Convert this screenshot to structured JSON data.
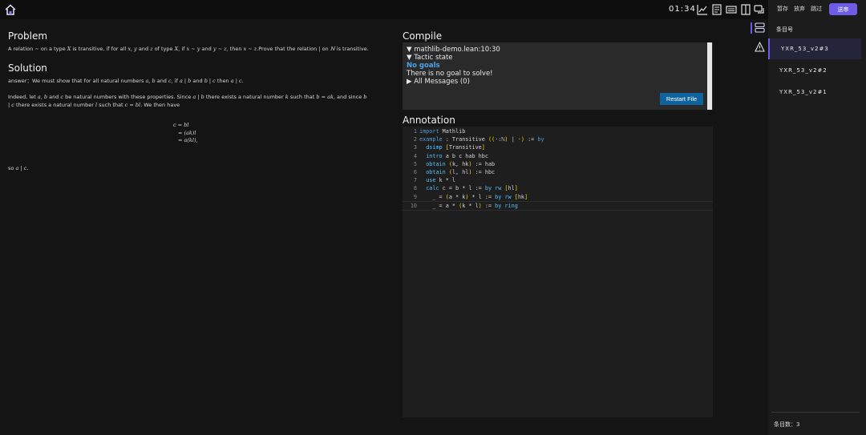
{
  "topbar": {
    "clock": "01:34",
    "icons": [
      "home-icon",
      "chart-icon",
      "document-icon",
      "keyboard-icon",
      "columns-icon",
      "chat-icon"
    ]
  },
  "problem": {
    "title": "Problem",
    "text_parts": [
      "A relation ",
      "∼",
      " on a type ",
      "X",
      " is transitive, if for all ",
      "x, y",
      " and ",
      "z",
      " of type ",
      "X,",
      " if ",
      "x ∼ y",
      " and ",
      "y ∼ z,",
      " then ",
      "x ∼ z",
      ".Prove that the relation ",
      "|",
      " on ",
      "ℕ",
      " is transitive."
    ]
  },
  "solution": {
    "title": "Solution",
    "answer_parts": [
      "answer：We must show that for all natural numbers ",
      "a, b",
      " and ",
      "c,",
      " if ",
      "a | b",
      " and ",
      "b | c",
      " then ",
      "a | c."
    ],
    "para_parts": [
      "Indeed, let ",
      "a, b",
      " and ",
      "c",
      " be natural numbers with these properties. Since ",
      "a | b",
      " there exists a natural number ",
      "k",
      " such that ",
      "b = ak,",
      " and since ",
      "b | c",
      " there exists a natural number ",
      "l",
      " such that ",
      "c = bl.",
      " We then have"
    ],
    "eq_lines": [
      "c = bl",
      "= (ak)l",
      "= a(kl),"
    ],
    "conclusion_parts": [
      "so ",
      "a | c."
    ]
  },
  "compile": {
    "title": "Compile",
    "file_line": "▼ mathlib-demo.lean:10:30",
    "tactic_state": "▼ Tactic state",
    "no_goals": "No goals",
    "no_goal_msg": "There is no goal to solve!",
    "all_messages": "▶ All Messages (0)",
    "restart_label": "Restart File"
  },
  "annotation": {
    "title": "Annotation",
    "lines": [
      {
        "n": "1",
        "segs": [
          [
            "kw",
            "import"
          ],
          [
            "",
            " Mathlib"
          ]
        ]
      },
      {
        "n": "2",
        "segs": [
          [
            "kw",
            "example"
          ],
          [
            "",
            " : Transitive "
          ],
          [
            "br",
            "("
          ],
          [
            "br",
            "("
          ],
          [
            "",
            "·:ℕ"
          ],
          [
            "br",
            ")"
          ],
          [
            "",
            " ∣ "
          ],
          [
            "br",
            "·"
          ],
          [
            "br",
            ")"
          ],
          [
            "",
            " := "
          ],
          [
            "kw",
            "by"
          ]
        ]
      },
      {
        "n": "3",
        "segs": [
          [
            "",
            "  "
          ],
          [
            "tac",
            "dsimp"
          ],
          [
            "",
            " "
          ],
          [
            "br",
            "["
          ],
          [
            "",
            "Transitive"
          ],
          [
            "br",
            "]"
          ]
        ]
      },
      {
        "n": "4",
        "segs": [
          [
            "",
            "  "
          ],
          [
            "tac",
            "intro"
          ],
          [
            "",
            " a b c hab hbc"
          ]
        ]
      },
      {
        "n": "5",
        "segs": [
          [
            "",
            "  "
          ],
          [
            "tac",
            "obtain"
          ],
          [
            "",
            " "
          ],
          [
            "br",
            "("
          ],
          [
            "",
            "k, hk"
          ],
          [
            "br",
            ")"
          ],
          [
            "",
            " := hab"
          ]
        ]
      },
      {
        "n": "6",
        "segs": [
          [
            "",
            "  "
          ],
          [
            "tac",
            "obtain"
          ],
          [
            "",
            " "
          ],
          [
            "br",
            "("
          ],
          [
            "",
            "l, hl"
          ],
          [
            "br",
            ")"
          ],
          [
            "",
            " := hbc"
          ]
        ]
      },
      {
        "n": "7",
        "segs": [
          [
            "",
            "  "
          ],
          [
            "tac",
            "use"
          ],
          [
            "",
            " k * l"
          ]
        ]
      },
      {
        "n": "8",
        "segs": [
          [
            "",
            "  "
          ],
          [
            "tac",
            "calc"
          ],
          [
            "",
            " c = b * l := "
          ],
          [
            "tac",
            "by"
          ],
          [
            "",
            " "
          ],
          [
            "tac",
            "rw"
          ],
          [
            "",
            " "
          ],
          [
            "br",
            "["
          ],
          [
            "",
            "hl"
          ],
          [
            "br",
            "]"
          ]
        ]
      },
      {
        "n": "9",
        "segs": [
          [
            "",
            "    _ = "
          ],
          [
            "br",
            "("
          ],
          [
            "",
            "a * k"
          ],
          [
            "br",
            ")"
          ],
          [
            "",
            " * l := "
          ],
          [
            "tac",
            "by"
          ],
          [
            "",
            " "
          ],
          [
            "tac",
            "rw"
          ],
          [
            "",
            " "
          ],
          [
            "br",
            "["
          ],
          [
            "",
            "hk"
          ],
          [
            "br",
            "]"
          ]
        ]
      },
      {
        "n": "10",
        "segs": [
          [
            "",
            "    _ = a * "
          ],
          [
            "br",
            "("
          ],
          [
            "",
            "k * l"
          ],
          [
            "br",
            ")"
          ],
          [
            "",
            " := "
          ],
          [
            "tac",
            "by"
          ],
          [
            "",
            " "
          ],
          [
            "tac",
            "ring"
          ]
        ]
      }
    ]
  },
  "sidebar": {
    "pause_label": "暂存",
    "abandon_label": "放弃",
    "skip_label": "跳过",
    "submit_label": "送审",
    "heading": "条目号",
    "items": [
      "YXR_53_v2#3",
      "YXR_53_v2#2",
      "YXR_53_v2#1"
    ],
    "count_label": "条目数：3",
    "accent": "#6c5ce7"
  }
}
